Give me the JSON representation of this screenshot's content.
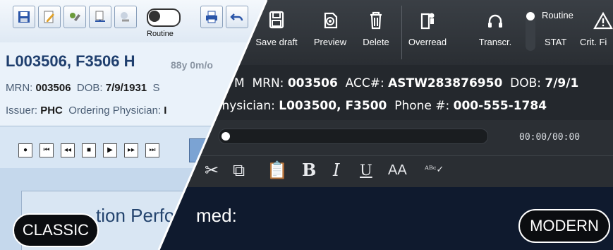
{
  "modern": {
    "toolbar": [
      {
        "label": "Save draft",
        "icon": "save-icon"
      },
      {
        "label": "Preview",
        "icon": "preview-icon"
      },
      {
        "label": "Delete",
        "icon": "trash-icon"
      },
      {
        "label": "Overread",
        "icon": "overread-icon"
      },
      {
        "label": "Transcr.",
        "icon": "headset-icon"
      },
      {
        "label": "Crit. Fi",
        "icon": "warning-icon"
      }
    ],
    "priority": {
      "option_top": "Routine",
      "option_bottom": "STAT"
    },
    "patient": {
      "line1_prefix": "M",
      "mrn_label": "MRN:",
      "mrn": "003506",
      "acc_label": "ACC#:",
      "acc": "ASTW283876950",
      "dob_label": "DOB:",
      "dob": "7/9/1",
      "line2_prefix": "g Physician:",
      "physician": "L003500, F3500",
      "phone_label": "Phone #:",
      "phone": "000-555-1784"
    },
    "player": {
      "time": "00:00/00:00",
      "progress": 0
    },
    "editor_icons": [
      "scissors-icon",
      "copy-icon",
      "paste-icon",
      "bold-icon",
      "italic-icon",
      "underline-icon",
      "font-size-icon",
      "spellcheck-icon"
    ],
    "editor_glyphs": {
      "bold": "B",
      "italic": "I",
      "underline": "U",
      "font_size": "AA"
    },
    "section_heading": "med:",
    "badge": "MODERN"
  },
  "classic": {
    "toolbar_icons": [
      "save-icon",
      "edit-icon",
      "sign-icon",
      "transfer-icon",
      "overread-icon"
    ],
    "priority_label": "Routine",
    "patient": {
      "name": "L003506, F3506 H",
      "age": "88y 0m/o",
      "mrn_label": "MRN:",
      "mrn": "003506",
      "dob_label": "DOB:",
      "dob": "7/9/1931",
      "tail": "S",
      "issuer_label": "Issuer:",
      "issuer": "PHC",
      "physician_label": "Ordering Physician:",
      "physician_fragment": "I"
    },
    "player_buttons": [
      "record",
      "skip-start",
      "rewind",
      "stop",
      "play",
      "fast-forward",
      "skip-end"
    ],
    "section_heading": "tion Perfo",
    "badge": "CLASSIC"
  }
}
